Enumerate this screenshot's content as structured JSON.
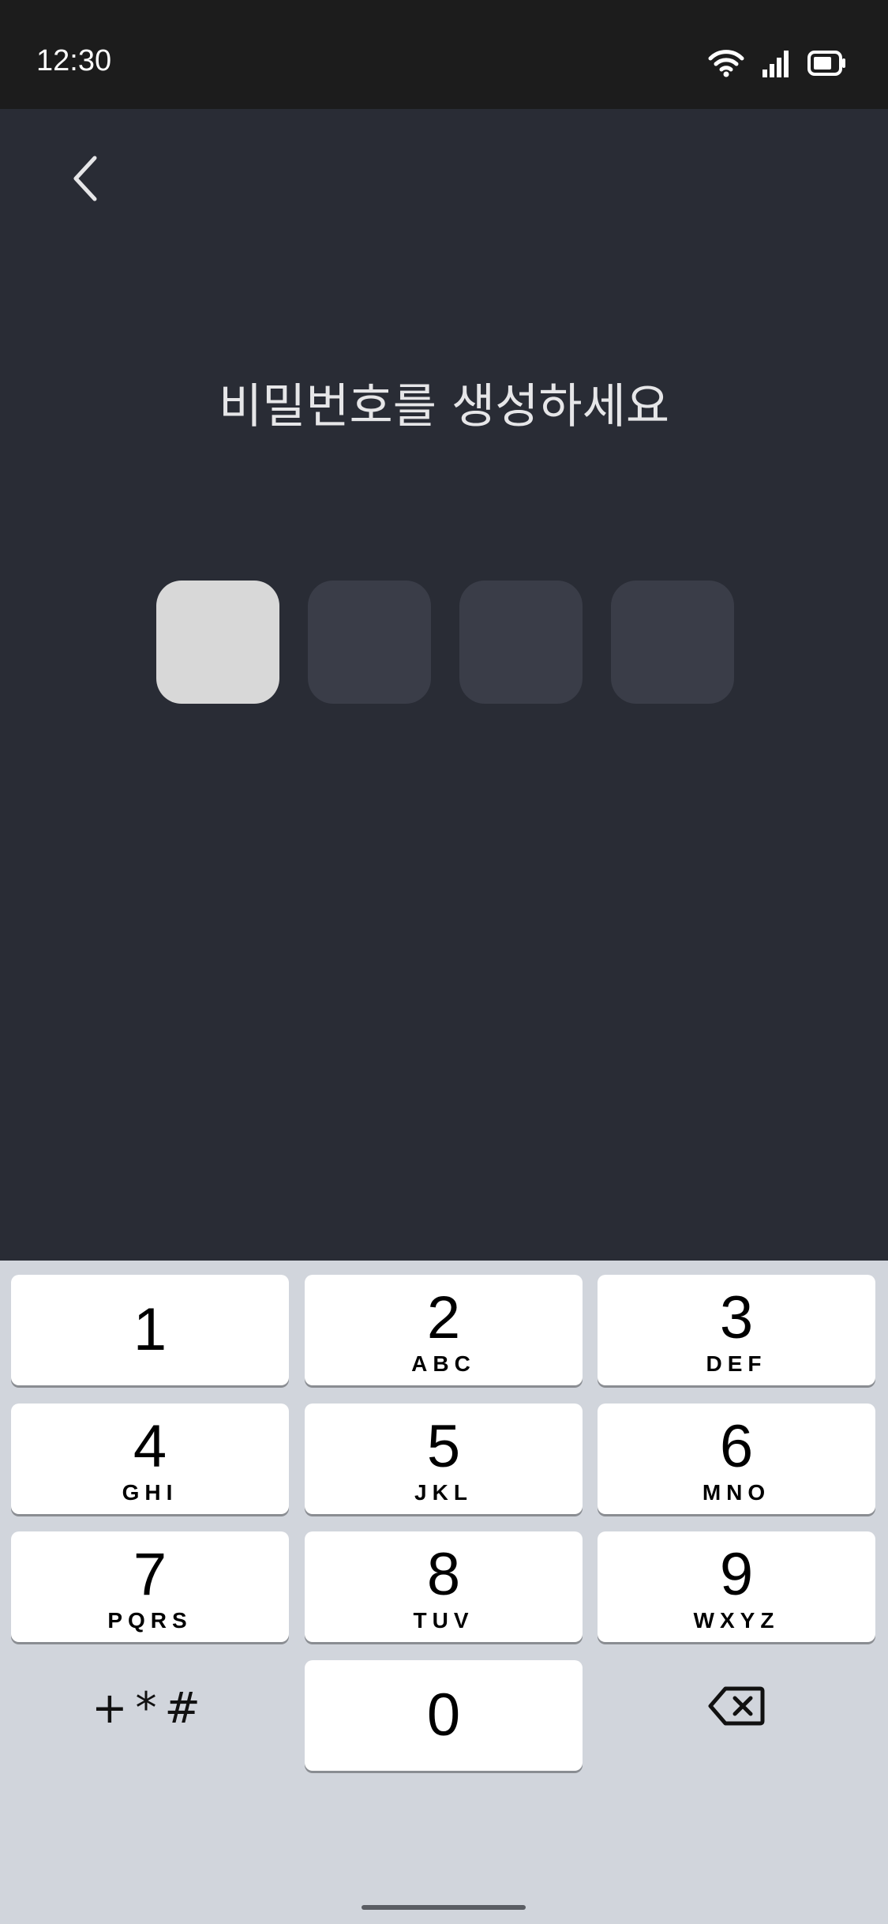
{
  "status_bar": {
    "time": "12:30"
  },
  "screen": {
    "title": "비밀번호를 생성하세요"
  },
  "pin": {
    "length": 4,
    "filled": 1
  },
  "keypad": {
    "keys": [
      {
        "digit": "1",
        "letters": ""
      },
      {
        "digit": "2",
        "letters": "ABC"
      },
      {
        "digit": "3",
        "letters": "DEF"
      },
      {
        "digit": "4",
        "letters": "GHI"
      },
      {
        "digit": "5",
        "letters": "JKL"
      },
      {
        "digit": "6",
        "letters": "MNO"
      },
      {
        "digit": "7",
        "letters": "PQRS"
      },
      {
        "digit": "8",
        "letters": "TUV"
      },
      {
        "digit": "9",
        "letters": "WXYZ"
      },
      {
        "digit": "0",
        "letters": ""
      }
    ],
    "symbols_label": "+*#",
    "backspace_icon": "backspace-icon"
  },
  "colors": {
    "background": "#292c35",
    "pin_filled": "#d8d8d8",
    "pin_empty": "#3a3d48",
    "keypad_bg": "#d1d5dc"
  }
}
